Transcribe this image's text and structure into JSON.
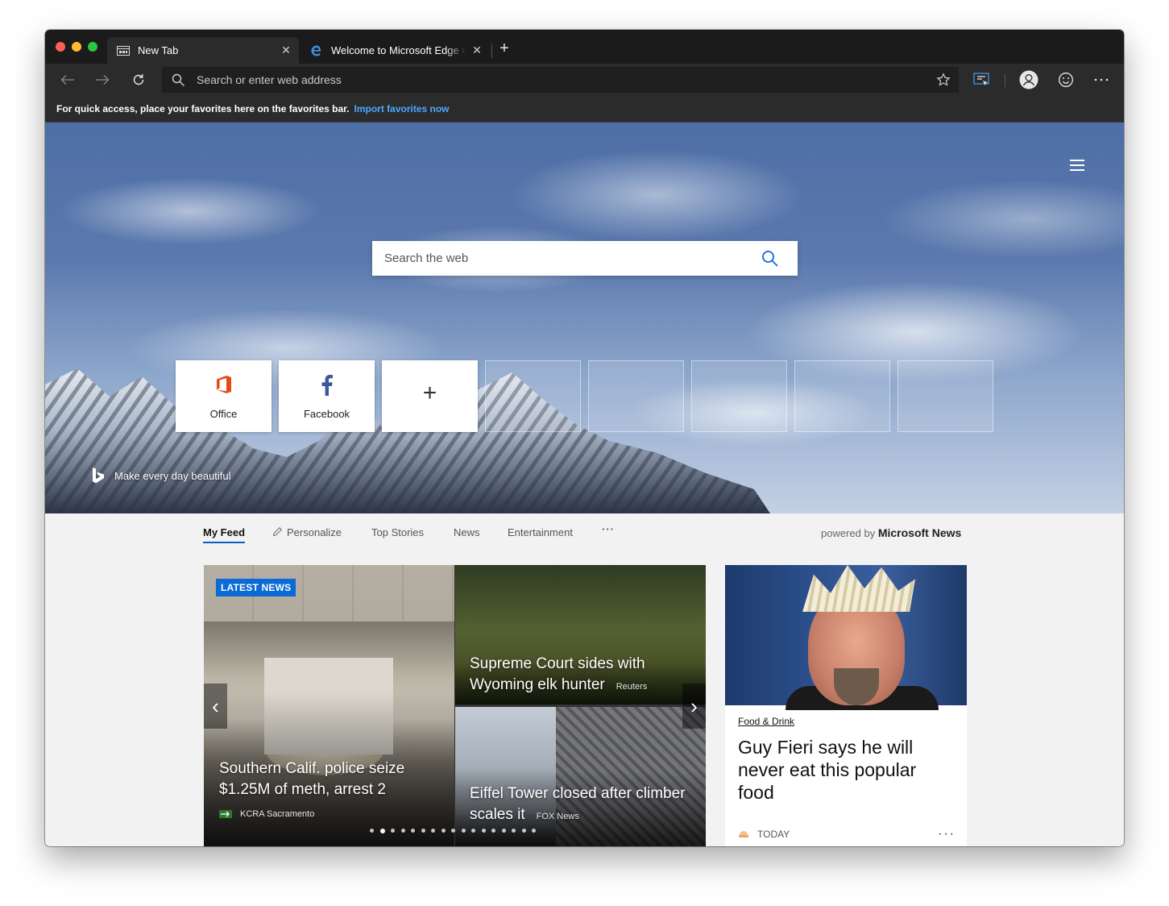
{
  "tabs": [
    {
      "title": "New Tab",
      "icon": "newtab-icon"
    },
    {
      "title": "Welcome to Microsoft Edge Canary Channel",
      "icon": "edge-icon"
    }
  ],
  "toolbar": {
    "address_placeholder": "Search or enter web address"
  },
  "favorites_bar": {
    "message": "For quick access, place your favorites here on the favorites bar.",
    "link": "Import favorites now"
  },
  "hero": {
    "search_placeholder": "Search the web",
    "tiles": [
      {
        "label": "Office",
        "icon": "office-icon"
      },
      {
        "label": "Facebook",
        "icon": "facebook-icon"
      },
      {
        "label": "+",
        "icon": "add-icon"
      }
    ],
    "bing_tagline": "Make every day beautiful"
  },
  "feed": {
    "tabs": [
      "My Feed",
      "Personalize",
      "Top Stories",
      "News",
      "Entertainment",
      "···"
    ],
    "powered_by_prefix": "powered by",
    "powered_by_brand": "Microsoft News",
    "badge": "LATEST NEWS",
    "stories": [
      {
        "headline": "Southern Calif. police seize $1.25M of meth, arrest 2",
        "source": "KCRA Sacramento"
      },
      {
        "headline": "Supreme Court sides with Wyoming elk hunter",
        "source": "Reuters"
      },
      {
        "headline": "Eiffel Tower closed after climber scales it",
        "source": "FOX News"
      }
    ],
    "carousel_dots": 17,
    "carousel_active_dot": 2,
    "side_card": {
      "category": "Food & Drink",
      "title": "Guy Fieri says he will never eat this popular food",
      "time": "TODAY"
    }
  },
  "colors": {
    "accent": "#0a6ad6",
    "link": "#4fa8ff",
    "chrome": "#2b2b2b"
  }
}
